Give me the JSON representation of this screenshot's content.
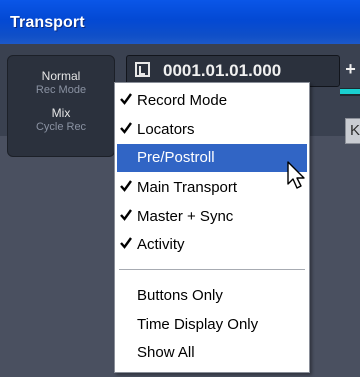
{
  "window": {
    "title": "Transport"
  },
  "mode_panel": {
    "record_mode_value": "Normal",
    "record_mode_label": "Rec Mode",
    "cycle_value": "Mix",
    "cycle_label": "Cycle Rec"
  },
  "time_display": {
    "value": "0001.01.01.000",
    "icon": "locator-icon"
  },
  "side_controls": {
    "plus_label": "+",
    "k_label": "K"
  },
  "context_menu": {
    "items": [
      {
        "label": "Record Mode",
        "checked": true,
        "highlighted": false
      },
      {
        "label": "Locators",
        "checked": true,
        "highlighted": false
      },
      {
        "label": "Pre/Postroll",
        "checked": false,
        "highlighted": true
      },
      {
        "label": "Main Transport",
        "checked": true,
        "highlighted": false
      },
      {
        "label": "Master + Sync",
        "checked": true,
        "highlighted": false
      },
      {
        "label": "Activity",
        "checked": true,
        "highlighted": false
      },
      {
        "label": "Buttons Only",
        "checked": false,
        "highlighted": false
      },
      {
        "label": "Time Display Only",
        "checked": false,
        "highlighted": false
      },
      {
        "label": "Show All",
        "checked": false,
        "highlighted": false
      }
    ]
  },
  "colors": {
    "titlebar": "#0a56e8",
    "highlight": "#3165c5",
    "panel": "#4a5060",
    "meter": "#1ad0d0"
  }
}
